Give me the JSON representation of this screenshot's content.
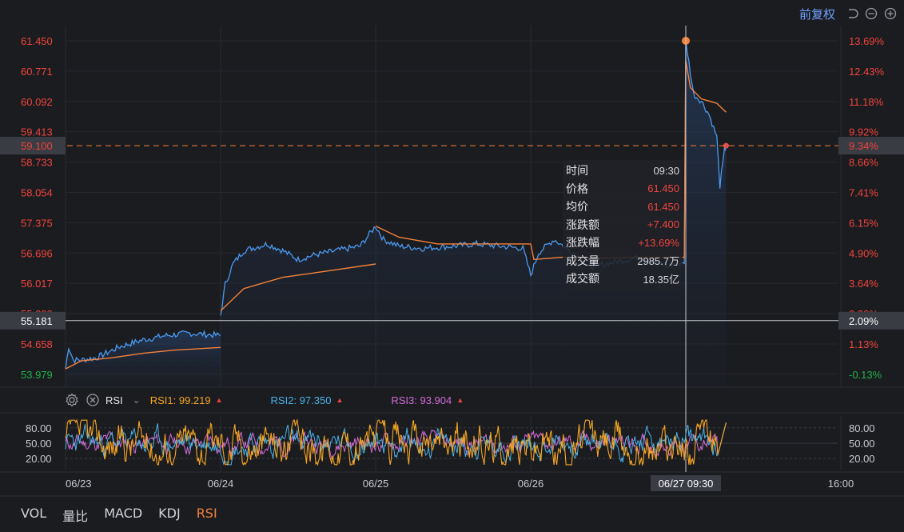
{
  "toolbar": {
    "adjust_label": "前复权",
    "icons": [
      "undo-icon",
      "zoom-out-icon",
      "zoom-in-icon"
    ]
  },
  "colors": {
    "up": "#f0443c",
    "down": "#20b04a",
    "price_line": "#4a9af0",
    "avg_line": "#f5813a",
    "rsi1": "#f5a623",
    "rsi2": "#4ab3e8",
    "rsi3": "#d36bd6",
    "accent": "#6fa0ff"
  },
  "chart_data": {
    "type": "line",
    "title": "",
    "days": [
      "06/23",
      "06/24",
      "06/25",
      "06/26",
      "06/27"
    ],
    "x_tick_labels": [
      "06/23",
      "06/24",
      "06/25",
      "06/26",
      "06/27 09:30",
      "16:00"
    ],
    "prev_close": 54.05,
    "ylim": [
      53.69,
      61.79
    ],
    "left_ticks": [
      "61.450",
      "60.771",
      "60.092",
      "59.413",
      "58.733",
      "58.054",
      "57.375",
      "56.696",
      "56.017",
      "55.338",
      "54.658",
      "53.979"
    ],
    "right_ticks": [
      "13.69%",
      "12.43%",
      "11.18%",
      "9.92%",
      "8.66%",
      "7.41%",
      "6.15%",
      "4.90%",
      "3.64%",
      "2.38%",
      "1.13%",
      "-0.13%"
    ],
    "tick_values": [
      61.45,
      60.771,
      60.092,
      59.413,
      58.733,
      58.054,
      57.375,
      56.696,
      56.017,
      55.338,
      54.658,
      53.979
    ],
    "crosshair_h": {
      "price": 55.181,
      "label_left": "55.181",
      "label_right": "2.09%"
    },
    "last_price": {
      "price": 59.1,
      "label_left": "59.100",
      "label_right": "9.34%"
    },
    "max_marker_price": 61.45,
    "series": [
      {
        "name": "price",
        "points": [
          [
            0,
            54.1
          ],
          [
            0.02,
            54.6
          ],
          [
            0.05,
            54.3
          ],
          [
            0.1,
            54.3
          ],
          [
            0.2,
            54.35
          ],
          [
            0.35,
            54.6
          ],
          [
            0.5,
            54.75
          ],
          [
            0.65,
            54.85
          ],
          [
            0.8,
            54.9
          ],
          [
            1.0,
            54.85
          ],
          [
            1.0,
            55.3
          ],
          [
            1.03,
            56.0
          ],
          [
            1.08,
            56.45
          ],
          [
            1.15,
            56.75
          ],
          [
            1.3,
            56.9
          ],
          [
            1.4,
            56.75
          ],
          [
            1.5,
            56.55
          ],
          [
            1.6,
            56.65
          ],
          [
            1.75,
            56.75
          ],
          [
            1.9,
            56.85
          ],
          [
            2.0,
            57.3
          ],
          [
            2.05,
            57.0
          ],
          [
            2.15,
            56.85
          ],
          [
            2.3,
            56.8
          ],
          [
            2.5,
            56.85
          ],
          [
            2.65,
            56.9
          ],
          [
            2.8,
            56.85
          ],
          [
            2.95,
            56.8
          ],
          [
            3.0,
            56.2
          ],
          [
            3.05,
            56.7
          ],
          [
            3.15,
            57.0
          ],
          [
            3.4,
            56.4
          ],
          [
            3.55,
            56.5
          ],
          [
            3.7,
            56.6
          ],
          [
            3.88,
            56.4
          ],
          [
            3.99,
            56.5
          ],
          [
            4.0,
            61.45
          ],
          [
            4.05,
            60.25
          ],
          [
            4.1,
            60.1
          ],
          [
            4.15,
            59.8
          ],
          [
            4.2,
            59.3
          ],
          [
            4.22,
            58.2
          ],
          [
            4.25,
            59.0
          ],
          [
            4.26,
            59.1
          ]
        ]
      },
      {
        "name": "avg",
        "points": [
          [
            0,
            54.1
          ],
          [
            0.1,
            54.28
          ],
          [
            0.3,
            54.35
          ],
          [
            0.5,
            54.45
          ],
          [
            0.7,
            54.52
          ],
          [
            1.0,
            54.58
          ],
          [
            1.0,
            55.4
          ],
          [
            1.15,
            55.9
          ],
          [
            1.4,
            56.15
          ],
          [
            1.7,
            56.3
          ],
          [
            2.0,
            56.45
          ],
          [
            2.0,
            57.3
          ],
          [
            2.15,
            57.05
          ],
          [
            2.4,
            56.9
          ],
          [
            2.7,
            56.9
          ],
          [
            3.0,
            56.9
          ],
          [
            3.02,
            56.55
          ],
          [
            3.2,
            56.6
          ],
          [
            3.4,
            56.58
          ],
          [
            3.7,
            56.6
          ],
          [
            3.99,
            56.6
          ],
          [
            4.0,
            61.0
          ],
          [
            4.03,
            60.4
          ],
          [
            4.1,
            60.15
          ],
          [
            4.2,
            60.05
          ],
          [
            4.26,
            59.85
          ]
        ]
      }
    ],
    "tooltip": [
      {
        "key": "时间",
        "value": "09:30"
      },
      {
        "key": "价格",
        "value": "61.450"
      },
      {
        "key": "均价",
        "value": "61.450"
      },
      {
        "key": "涨跌额",
        "value": "+7.400"
      },
      {
        "key": "涨跌幅",
        "value": "+13.69%"
      },
      {
        "key": "成交量",
        "value": "2985.7万"
      },
      {
        "key": "成交额",
        "value": "18.35亿"
      }
    ],
    "rsi": {
      "name": "RSI",
      "ticks": [
        "80.00",
        "50.00",
        "20.00"
      ],
      "tick_values": [
        80,
        50,
        20
      ],
      "ylim": [
        0,
        100
      ],
      "values": [
        {
          "name": "RSI1",
          "value": "99.219"
        },
        {
          "name": "RSI2",
          "value": "97.350"
        },
        {
          "name": "RSI3",
          "value": "93.904"
        }
      ]
    }
  },
  "bottom_tabs": [
    "VOL",
    "量比",
    "MACD",
    "KDJ",
    "RSI"
  ],
  "active_tab": "RSI"
}
